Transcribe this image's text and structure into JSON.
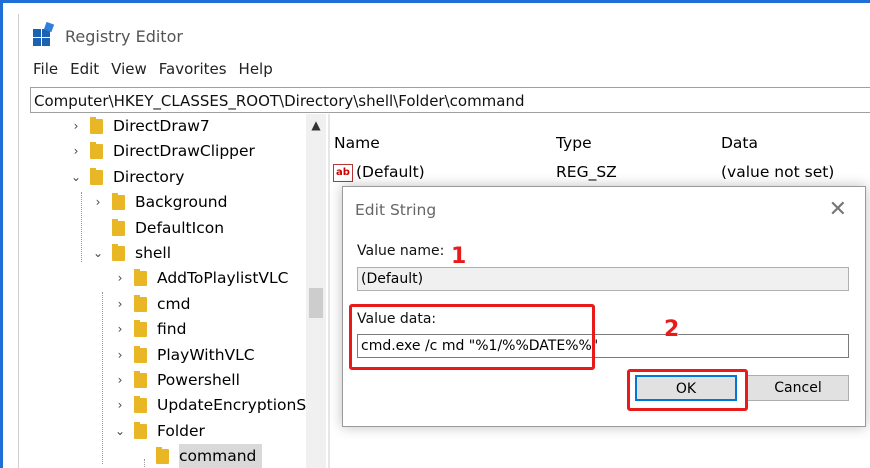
{
  "window": {
    "title": "Registry Editor"
  },
  "menu": [
    "File",
    "Edit",
    "View",
    "Favorites",
    "Help"
  ],
  "address": "Computer\\HKEY_CLASSES_ROOT\\Directory\\shell\\Folder\\command",
  "tree": [
    {
      "label": "DirectDraw7",
      "chevron": "›",
      "level": 0
    },
    {
      "label": "DirectDrawClipper",
      "chevron": "›",
      "level": 0
    },
    {
      "label": "Directory",
      "chevron": "⌄",
      "level": 0
    },
    {
      "label": "Background",
      "chevron": "›",
      "level": 1
    },
    {
      "label": "DefaultIcon",
      "chevron": "",
      "level": 1
    },
    {
      "label": "shell",
      "chevron": "⌄",
      "level": 1
    },
    {
      "label": "AddToPlaylistVLC",
      "chevron": "›",
      "level": 2
    },
    {
      "label": "cmd",
      "chevron": "›",
      "level": 2
    },
    {
      "label": "find",
      "chevron": "›",
      "level": 2
    },
    {
      "label": "PlayWithVLC",
      "chevron": "›",
      "level": 2
    },
    {
      "label": "Powershell",
      "chevron": "›",
      "level": 2
    },
    {
      "label": "UpdateEncryptionSet",
      "chevron": "›",
      "level": 2
    },
    {
      "label": "Folder",
      "chevron": "⌄",
      "level": 2
    },
    {
      "label": "command",
      "chevron": "",
      "level": 3,
      "selected": true
    }
  ],
  "list": {
    "headers": {
      "name": "Name",
      "type": "Type",
      "data": "Data"
    },
    "rows": [
      {
        "icon": "ab",
        "name": "(Default)",
        "type": "REG_SZ",
        "data": "(value not set)"
      }
    ]
  },
  "dialog": {
    "title": "Edit String",
    "close_glyph": "✕",
    "value_name_label": "Value name:",
    "value_name": "(Default)",
    "value_data_label": "Value data:",
    "value_data": "cmd.exe /c md \"%1/%%DATE%%\"",
    "ok_label": "OK",
    "cancel_label": "Cancel"
  },
  "annotations": {
    "step1": "1",
    "step2": "2",
    "color": "#e81a1a"
  },
  "colors": {
    "accent": "#0078d7",
    "folder": "#e9b626",
    "icon_blue": "#1b62b5"
  }
}
